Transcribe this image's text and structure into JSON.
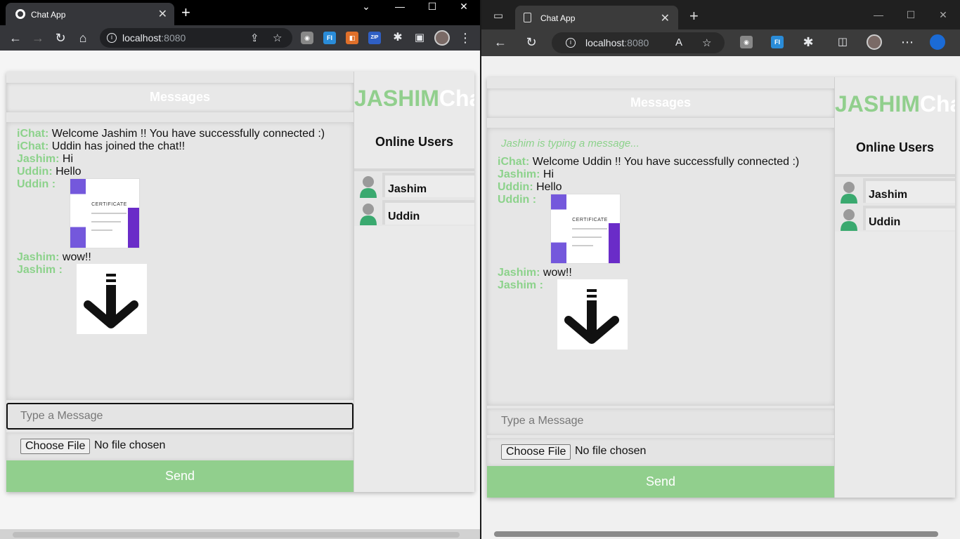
{
  "left": {
    "tab_title": "Chat App",
    "url_host": "localhost",
    "url_port": ":8080",
    "ext_zip": "ZIP",
    "ext_fi": "FI",
    "messages_header": "Messages",
    "messages": [
      {
        "who": "iChat:",
        "text": " Welcome Jashim !! You have successfully connected :)"
      },
      {
        "who": "iChat:",
        "text": " Uddin has joined the chat!!"
      },
      {
        "who": "Jashim:",
        "text": " Hi"
      },
      {
        "who": "Uddin:",
        "text": " Hello"
      },
      {
        "who": "Uddin :",
        "image": "certificate"
      },
      {
        "who": "Jashim:",
        "text": " wow!!"
      },
      {
        "who": "Jashim :",
        "image": "download-arrow"
      }
    ],
    "input_placeholder": "Type a Message",
    "choose_file": "Choose File",
    "no_file": "No file chosen",
    "send": "Send",
    "brand_green": "JASHIM",
    "brand_white": "Cha",
    "online_users": "Online Users",
    "users": [
      "Jashim",
      "Uddin"
    ]
  },
  "right": {
    "tab_title": "Chat App",
    "url_host": "localhost",
    "url_port": ":8080",
    "ext_fi": "FI",
    "messages_header": "Messages",
    "typing": "Jashim is typing a message...",
    "messages": [
      {
        "who": "iChat:",
        "text": " Welcome Uddin !! You have successfully connected :)"
      },
      {
        "who": "Jashim:",
        "text": " Hi"
      },
      {
        "who": "Uddin:",
        "text": " Hello"
      },
      {
        "who": "Uddin :",
        "image": "certificate"
      },
      {
        "who": "Jashim:",
        "text": " wow!!"
      },
      {
        "who": "Jashim :",
        "image": "download-arrow"
      }
    ],
    "input_placeholder": "Type a Message",
    "choose_file": "Choose File",
    "no_file": "No file chosen",
    "send": "Send",
    "brand_green": "JASHIM",
    "brand_white": "Cha",
    "online_users": "Online Users",
    "users": [
      "Jashim",
      "Uddin"
    ]
  },
  "certificate_text": "CERTIFICATE",
  "colors": {
    "accent": "#91cf8d",
    "chrome_dark": "#35363a",
    "edge_dark": "#3b3b3b"
  }
}
